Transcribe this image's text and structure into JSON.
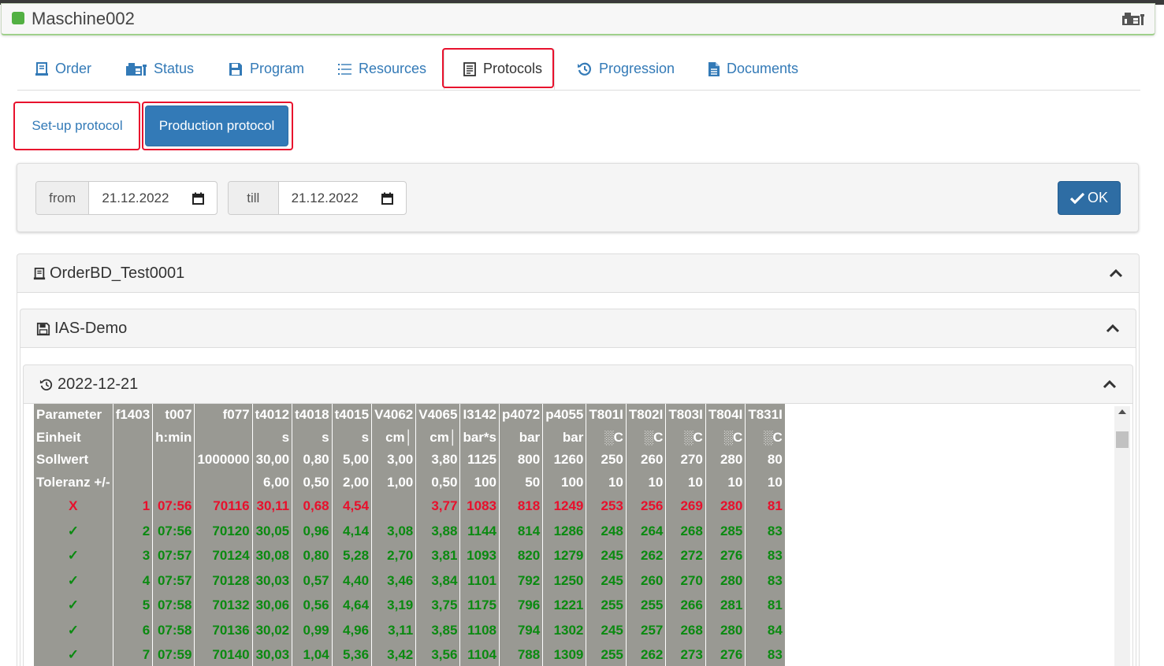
{
  "machine": {
    "title": "Maschine002"
  },
  "tabs": [
    {
      "label": "Order",
      "icon": "order-icon"
    },
    {
      "label": "Status",
      "icon": "machine-icon"
    },
    {
      "label": "Program",
      "icon": "floppy-icon"
    },
    {
      "label": "Resources",
      "icon": "list-icon"
    },
    {
      "label": "Protocols",
      "icon": "protocol-icon",
      "active": true
    },
    {
      "label": "Progression",
      "icon": "history-icon"
    },
    {
      "label": "Documents",
      "icon": "document-icon"
    }
  ],
  "subtabs": {
    "setup_label": "Set-up protocol",
    "production_label": "Production protocol",
    "active": "production"
  },
  "filter": {
    "from_label": "from",
    "from_value": "21.12.2022",
    "till_label": "till",
    "till_value": "21.12.2022",
    "ok_label": "OK"
  },
  "panels": {
    "order": "OrderBD_Test0001",
    "program": "IAS-Demo",
    "date": "2022-12-21"
  },
  "colors": {
    "accent": "#337ab7",
    "table_bg": "#999993",
    "ok_green": "#0a8a10",
    "error_red": "#e8102c"
  },
  "table": {
    "header_rows": [
      [
        "Parameter",
        "f1403",
        "t007",
        "f077",
        "t4012",
        "t4018",
        "t4015",
        "V4062",
        "V4065",
        "I3142",
        "p4072",
        "p4055",
        "T801I",
        "T802I",
        "T803I",
        "T804I",
        "T831I"
      ],
      [
        "Einheit",
        "",
        "h:min",
        "",
        "s",
        "s",
        "s",
        "cm│",
        "cm│",
        "bar*s",
        "bar",
        "bar",
        "░C",
        "░C",
        "░C",
        "░C",
        "░C"
      ],
      [
        "Sollwert",
        "",
        "",
        "1000000",
        "30,00",
        "0,80",
        "5,00",
        "3,00",
        "3,80",
        "1125",
        "800",
        "1260",
        "250",
        "260",
        "270",
        "280",
        "80"
      ],
      [
        "Toleranz +/-",
        "",
        "",
        "",
        "6,00",
        "0,50",
        "2,00",
        "1,00",
        "0,50",
        "100",
        "50",
        "100",
        "10",
        "10",
        "10",
        "10",
        "10"
      ]
    ],
    "rows": [
      {
        "status": "X",
        "ok": false,
        "cells": [
          "1",
          "07:56",
          "70116",
          "30,11",
          "0,68",
          "4,54",
          "",
          "3,77",
          "1083",
          "818",
          "1249",
          "253",
          "256",
          "269",
          "280",
          "81"
        ]
      },
      {
        "status": "✓",
        "ok": true,
        "cells": [
          "2",
          "07:56",
          "70120",
          "30,05",
          "0,96",
          "4,14",
          "3,08",
          "3,88",
          "1144",
          "814",
          "1286",
          "248",
          "264",
          "268",
          "285",
          "83"
        ]
      },
      {
        "status": "✓",
        "ok": true,
        "cells": [
          "3",
          "07:57",
          "70124",
          "30,08",
          "0,80",
          "5,28",
          "2,70",
          "3,81",
          "1093",
          "820",
          "1279",
          "245",
          "262",
          "272",
          "276",
          "83"
        ]
      },
      {
        "status": "✓",
        "ok": true,
        "cells": [
          "4",
          "07:57",
          "70128",
          "30,03",
          "0,57",
          "4,40",
          "3,46",
          "3,84",
          "1101",
          "792",
          "1250",
          "245",
          "260",
          "270",
          "280",
          "83"
        ]
      },
      {
        "status": "✓",
        "ok": true,
        "cells": [
          "5",
          "07:58",
          "70132",
          "30,06",
          "0,56",
          "4,64",
          "3,19",
          "3,75",
          "1175",
          "796",
          "1221",
          "255",
          "255",
          "266",
          "281",
          "81"
        ]
      },
      {
        "status": "✓",
        "ok": true,
        "cells": [
          "6",
          "07:58",
          "70136",
          "30,02",
          "0,99",
          "4,96",
          "3,11",
          "3,85",
          "1108",
          "794",
          "1302",
          "245",
          "257",
          "268",
          "280",
          "84"
        ]
      },
      {
        "status": "✓",
        "ok": true,
        "cells": [
          "7",
          "07:59",
          "70140",
          "30,03",
          "1,04",
          "5,36",
          "3,42",
          "3,56",
          "1104",
          "788",
          "1309",
          "255",
          "262",
          "273",
          "276",
          "83"
        ]
      }
    ]
  }
}
